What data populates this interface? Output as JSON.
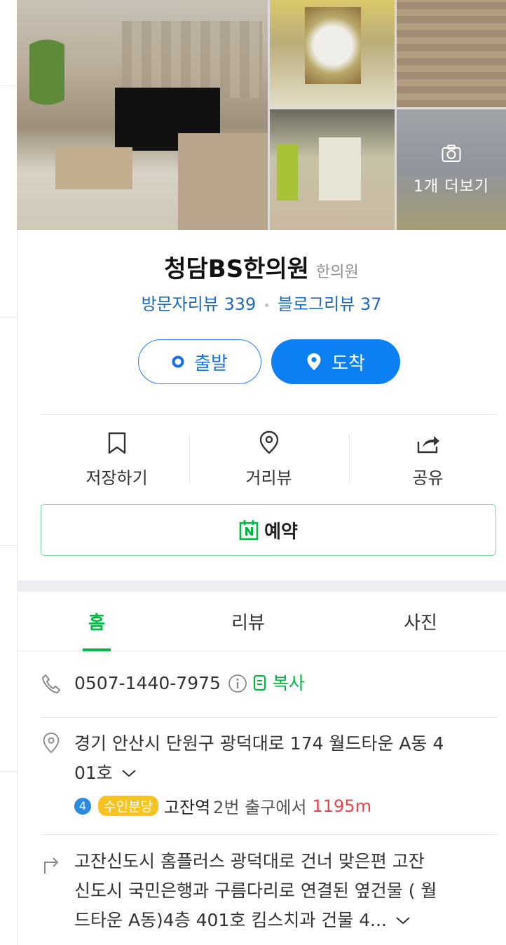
{
  "gallery": {
    "more_label": "1개 더보기"
  },
  "place": {
    "name": "청담BS한의원",
    "category": "한의원",
    "visitor_review": "방문자리뷰 339",
    "blog_review": "블로그리뷰 37"
  },
  "route": {
    "depart_label": "출발",
    "arrive_label": "도착"
  },
  "actions": {
    "save_label": "저장하기",
    "streetview_label": "거리뷰",
    "share_label": "공유"
  },
  "reserve": {
    "label": "예약"
  },
  "tabs": [
    {
      "label": "홈",
      "active": true
    },
    {
      "label": "리뷰",
      "active": false
    },
    {
      "label": "사진",
      "active": false
    }
  ],
  "info": {
    "phone": "0507-1440-7975",
    "copy_label": "복사",
    "address_line1": "경기 안산시 단원구 광덕대로 174 월드타운 A동 4",
    "address_line2": "01호",
    "subway_line_no": "4",
    "subway_line_name": "수인분당",
    "station": "고잔역",
    "exit_text": "2번 출구에서",
    "distance": "1195m",
    "directions_line1": "고잔신도시 홈플러스 광덕대로 건너 맞은편 고잔",
    "directions_line2": "신도시 국민은행과 구름다리로 연결된 옆건물 ( 월",
    "directions_line3": "드타운 A동)4층 401호 킴스치과 건물 4..."
  },
  "colors": {
    "naver_green": "#02b843",
    "link_blue": "#1e6bb8",
    "primary_button": "#0c7ff2",
    "distance_red": "#ef4149",
    "line4_blue": "#2a8ae0",
    "suin_bundang_yellow": "#f6c321"
  }
}
